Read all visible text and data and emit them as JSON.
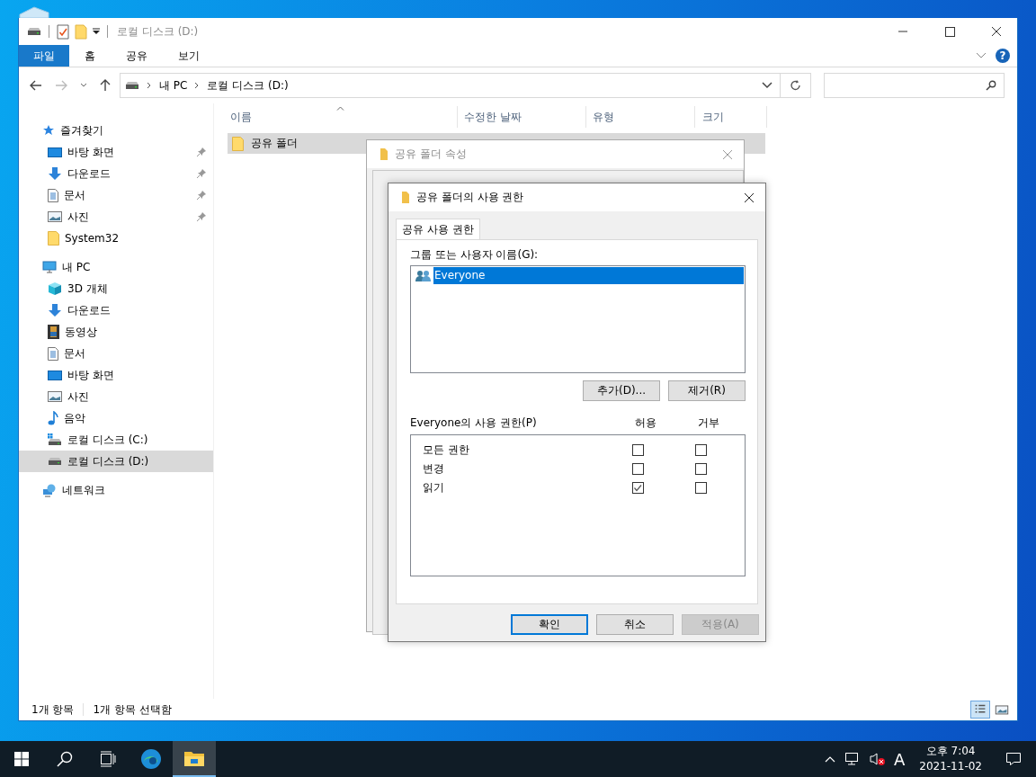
{
  "explorer": {
    "title": "로컬 디스크 (D:)",
    "ribbon_tabs": [
      {
        "label": "파일",
        "selected": true
      },
      {
        "label": "홈",
        "selected": false
      },
      {
        "label": "공유",
        "selected": false
      },
      {
        "label": "보기",
        "selected": false
      }
    ],
    "help": "?",
    "address": {
      "crumbs": [
        "내 PC",
        "로컬 디스크 (D:)"
      ]
    },
    "sidebar": {
      "items": [
        {
          "label": "즐겨찾기",
          "kind": "star",
          "selected": false,
          "children": [
            {
              "label": "바탕 화면",
              "kind": "desktop",
              "pinned": true,
              "selected": false
            },
            {
              "label": "다운로드",
              "kind": "download",
              "pinned": true,
              "selected": false
            },
            {
              "label": "문서",
              "kind": "document",
              "pinned": true,
              "selected": false
            },
            {
              "label": "사진",
              "kind": "picture",
              "pinned": true,
              "selected": false
            },
            {
              "label": "System32",
              "kind": "folder",
              "pinned": false,
              "selected": false
            }
          ]
        },
        {
          "label": "내 PC",
          "kind": "pc",
          "selected": false,
          "children": [
            {
              "label": "3D 개체",
              "kind": "cube",
              "pinned": false,
              "selected": false
            },
            {
              "label": "다운로드",
              "kind": "download",
              "pinned": false,
              "selected": false
            },
            {
              "label": "동영상",
              "kind": "video",
              "pinned": false,
              "selected": false
            },
            {
              "label": "문서",
              "kind": "document",
              "pinned": false,
              "selected": false
            },
            {
              "label": "바탕 화면",
              "kind": "desktop",
              "pinned": false,
              "selected": false
            },
            {
              "label": "사진",
              "kind": "picture",
              "pinned": false,
              "selected": false
            },
            {
              "label": "음악",
              "kind": "music",
              "pinned": false,
              "selected": false
            },
            {
              "label": "로컬 디스크 (C:)",
              "kind": "system-drive",
              "pinned": false,
              "selected": false
            },
            {
              "label": "로컬 디스크 (D:)",
              "kind": "drive",
              "pinned": false,
              "selected": true
            }
          ]
        },
        {
          "label": "네트워크",
          "kind": "network",
          "selected": false
        }
      ]
    },
    "columns": [
      "이름",
      "수정한 날짜",
      "유형",
      "크기"
    ],
    "rows": [
      {
        "name": "공유 폴더",
        "selected": true
      }
    ],
    "status_bar": {
      "count": "1개 항목",
      "selection": "1개 항목 선택함"
    },
    "views": [
      {
        "kind": "details",
        "selected": true
      },
      {
        "kind": "large-icons",
        "selected": false
      }
    ]
  },
  "properties_dialog": {
    "title": "공유 폴더 속성"
  },
  "permissions_dialog": {
    "title": "공유 폴더의 사용 권한",
    "tabs": [
      {
        "label": "공유 사용 권한",
        "selected": true
      }
    ],
    "users_label": "그룹 또는 사용자 이름(G):",
    "users": [
      {
        "name": "Everyone",
        "selected": true
      }
    ],
    "user_buttons": [
      "추가(D)...",
      "제거(R)"
    ],
    "permissions_label": "Everyone의 사용 권한(P)",
    "permission_columns": [
      "허용",
      "거부"
    ],
    "permissions": [
      {
        "name": "모든 권한",
        "allow": false,
        "deny": false
      },
      {
        "name": "변경",
        "allow": false,
        "deny": false
      },
      {
        "name": "읽기",
        "allow": true,
        "deny": false
      }
    ],
    "footer_buttons": [
      {
        "label": "확인",
        "default": true,
        "disabled": false
      },
      {
        "label": "취소",
        "default": false,
        "disabled": false
      },
      {
        "label": "적용(A)",
        "default": false,
        "disabled": true
      }
    ]
  },
  "taskbar": {
    "apps": [
      {
        "kind": "start",
        "selected": false
      },
      {
        "kind": "search",
        "selected": false
      },
      {
        "kind": "task-view",
        "selected": false
      },
      {
        "kind": "browser",
        "selected": false
      },
      {
        "kind": "file-explorer",
        "selected": true
      }
    ],
    "ime": "A",
    "time": "오후 7:04",
    "date": "2021-11-02"
  }
}
